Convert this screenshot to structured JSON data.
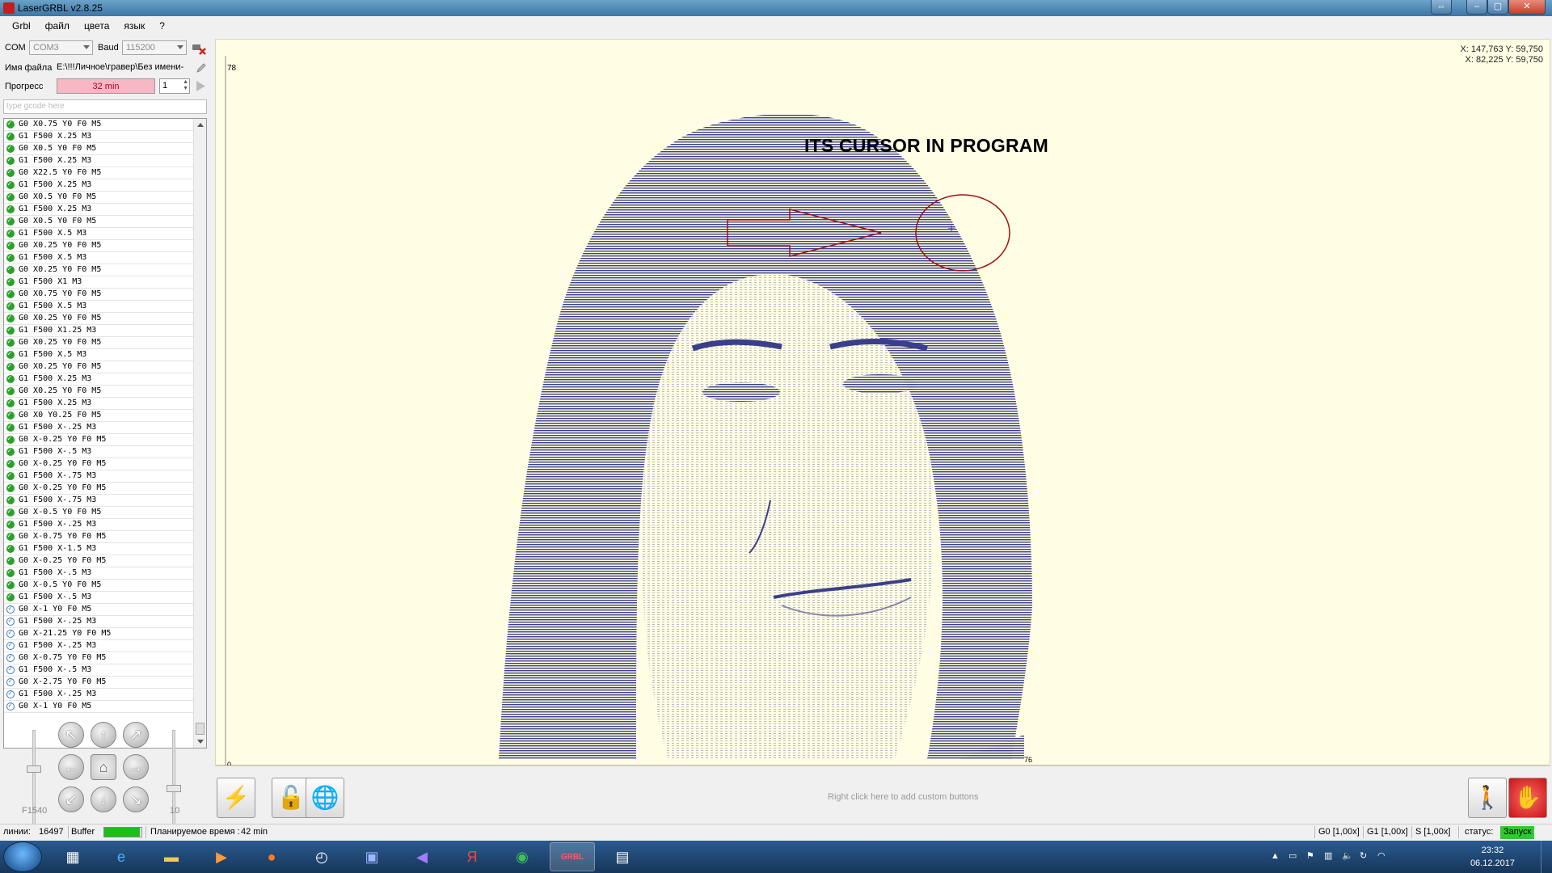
{
  "window": {
    "title": "LaserGRBL v2.8.25"
  },
  "menu": [
    "Grbl",
    "файл",
    "цвета",
    "язык",
    "?"
  ],
  "connection": {
    "com_label": "COM",
    "com_value": "COM3",
    "baud_label": "Baud",
    "baud_value": "115200"
  },
  "file": {
    "label": "Имя файла",
    "path": "E:\\!!!Личное\\гравер\\Без имени-"
  },
  "progress": {
    "label": "Прогресс",
    "text": "32 min",
    "fraction": 1.0,
    "copies": "1"
  },
  "gcode_input": {
    "placeholder": "type gcode here"
  },
  "gcode_lines": [
    {
      "text": "G0 X0.75 Y0 F0 M5",
      "done": true
    },
    {
      "text": "G1 F500 X.25 M3",
      "done": true
    },
    {
      "text": "G0 X0.5 Y0 F0 M5",
      "done": true
    },
    {
      "text": "G1 F500 X.25 M3",
      "done": true
    },
    {
      "text": "G0 X22.5 Y0 F0 M5",
      "done": true
    },
    {
      "text": "G1 F500 X.25 M3",
      "done": true
    },
    {
      "text": "G0 X0.5 Y0 F0 M5",
      "done": true
    },
    {
      "text": "G1 F500 X.25 M3",
      "done": true
    },
    {
      "text": "G0 X0.5 Y0 F0 M5",
      "done": true
    },
    {
      "text": "G1 F500 X.5 M3",
      "done": true
    },
    {
      "text": "G0 X0.25 Y0 F0 M5",
      "done": true
    },
    {
      "text": "G1 F500 X.5 M3",
      "done": true
    },
    {
      "text": "G0 X0.25 Y0 F0 M5",
      "done": true
    },
    {
      "text": "G1 F500 X1 M3",
      "done": true
    },
    {
      "text": "G0 X0.75 Y0 F0 M5",
      "done": true
    },
    {
      "text": "G1 F500 X.5 M3",
      "done": true
    },
    {
      "text": "G0 X0.25 Y0 F0 M5",
      "done": true
    },
    {
      "text": "G1 F500 X1.25 M3",
      "done": true
    },
    {
      "text": "G0 X0.25 Y0 F0 M5",
      "done": true
    },
    {
      "text": "G1 F500 X.5 M3",
      "done": true
    },
    {
      "text": "G0 X0.25 Y0 F0 M5",
      "done": true
    },
    {
      "text": "G1 F500 X.25 M3",
      "done": true
    },
    {
      "text": "G0 X0.25 Y0 F0 M5",
      "done": true
    },
    {
      "text": "G1 F500 X.25 M3",
      "done": true
    },
    {
      "text": "G0 X0 Y0.25 F0 M5",
      "done": true
    },
    {
      "text": "G1 F500 X-.25 M3",
      "done": true
    },
    {
      "text": "G0 X-0.25 Y0 F0 M5",
      "done": true
    },
    {
      "text": "G1 F500 X-.5 M3",
      "done": true
    },
    {
      "text": "G0 X-0.25 Y0 F0 M5",
      "done": true
    },
    {
      "text": "G1 F500 X-.75 M3",
      "done": true
    },
    {
      "text": "G0 X-0.25 Y0 F0 M5",
      "done": true
    },
    {
      "text": "G1 F500 X-.75 M3",
      "done": true
    },
    {
      "text": "G0 X-0.5 Y0 F0 M5",
      "done": true
    },
    {
      "text": "G1 F500 X-.25 M3",
      "done": true
    },
    {
      "text": "G0 X-0.75 Y0 F0 M5",
      "done": true
    },
    {
      "text": "G1 F500 X-1.5 M3",
      "done": true
    },
    {
      "text": "G0 X-0.25 Y0 F0 M5",
      "done": true
    },
    {
      "text": "G1 F500 X-.5 M3",
      "done": true
    },
    {
      "text": "G0 X-0.5 Y0 F0 M5",
      "done": true
    },
    {
      "text": "G1 F500 X-.5 M3",
      "done": true
    },
    {
      "text": "G0 X-1 Y0 F0 M5",
      "done": false
    },
    {
      "text": "G1 F500 X-.25 M3",
      "done": false
    },
    {
      "text": "G0 X-21.25 Y0 F0 M5",
      "done": false
    },
    {
      "text": "G1 F500 X-.25 M3",
      "done": false
    },
    {
      "text": "G0 X-0.75 Y0 F0 M5",
      "done": false
    },
    {
      "text": "G1 F500 X-.5 M3",
      "done": false
    },
    {
      "text": "G0 X-2.75 Y0 F0 M5",
      "done": false
    },
    {
      "text": "G1 F500 X-.25 M3",
      "done": false
    },
    {
      "text": "G0 X-1 Y0 F0 M5",
      "done": false
    }
  ],
  "jog": {
    "speed_label": "F1540",
    "step_label": "10"
  },
  "canvas": {
    "coord_line1": "X: 147,763 Y: 59,750",
    "coord_line2": "X: 82,225 Y: 59,750",
    "ruler_top": "78",
    "ruler_origin": "0",
    "ruler_right": "76",
    "annotation": "ITS CURSOR IN PROGRAM",
    "image_desc": "engraving preview portrait"
  },
  "bottom": {
    "custom_hint": "Right click here to add custom buttons"
  },
  "status": {
    "lines_label": "линии:",
    "lines_value": "16497",
    "buffer_label": "Buffer",
    "buffer_fraction": 0.95,
    "time_label": "Планируемое время :",
    "time_value": "42 min",
    "g0": "G0 [1,00x]",
    "g1": "G1 [1,00x]",
    "s": "S [1,00x]",
    "state_label": "статус:",
    "state_value": "Запуск"
  },
  "taskbar": {
    "time": "23:32",
    "date": "06.12.2017"
  },
  "colors": {
    "canvas_bg": "#fffde4",
    "engrave": "#3b3f8a",
    "progress_fill": "#f7b8c6",
    "status_ok": "#34c634",
    "annotation": "#a01010"
  }
}
